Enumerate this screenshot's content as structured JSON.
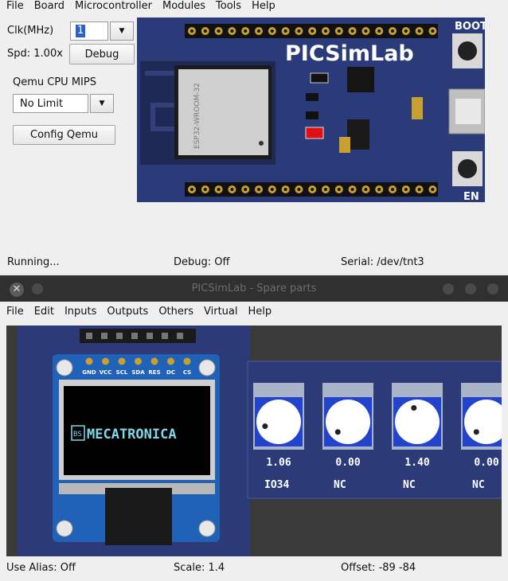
{
  "top_window": {
    "menu": [
      "File",
      "Board",
      "Microcontroller",
      "Modules",
      "Tools",
      "Help"
    ],
    "clk_label": "Clk(MHz)",
    "clk_value": "1",
    "spd_label": "Spd: 1.00x",
    "debug_button": "Debug",
    "qemu_label": "Qemu CPU MIPS",
    "qemu_value": "No Limit",
    "config_button": "Config Qemu",
    "board": {
      "title": "PICSimLab",
      "module_label": "ESP32-WROOM-32",
      "boot_label": "BOOT",
      "en_label": "EN"
    },
    "status": {
      "left": "Running...",
      "center": "Debug: Off",
      "right": "Serial: /dev/tnt3"
    }
  },
  "spare_window": {
    "title": "PICSimLab - Spare parts",
    "menu": [
      "File",
      "Edit",
      "Inputs",
      "Outputs",
      "Others",
      "Virtual",
      "Help"
    ],
    "oled": {
      "pins": [
        "GND",
        "VCC",
        "SCL",
        "SDA",
        "RES",
        "DC",
        "CS"
      ],
      "text": "MECATRONICA",
      "logo": "BS"
    },
    "pots": [
      {
        "value": "1.06",
        "pin": "IO34",
        "level": 0.1
      },
      {
        "value": "0.00",
        "pin": "NC",
        "level": 0.0
      },
      {
        "value": "1.40",
        "pin": "NC",
        "level": 0.45
      },
      {
        "value": "0.00",
        "pin": "NC",
        "level": 0.0
      }
    ],
    "status": {
      "left": "Use Alias: Off",
      "center": "Scale: 1.4",
      "right": "Offset: -89 -84"
    }
  },
  "colors": {
    "board_bg": "#2b3a78",
    "gold": "#c8a030",
    "pot_blue": "#2244cc",
    "oled_text": "#7fd8ea",
    "workspace": "#3b3b3b",
    "panel": "#2c3b78"
  }
}
